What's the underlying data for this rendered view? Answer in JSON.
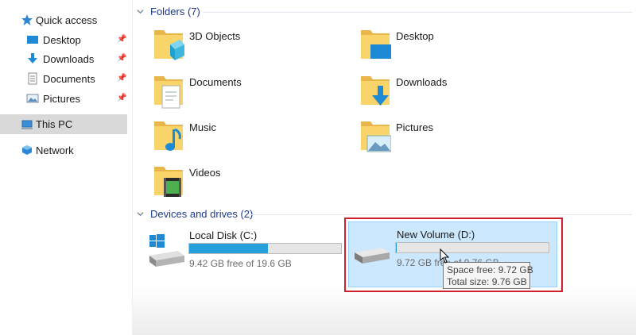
{
  "sidebar": {
    "quick_access": "Quick access",
    "items": [
      {
        "label": "Desktop",
        "icon": "desktop-icon",
        "pinned": true
      },
      {
        "label": "Downloads",
        "icon": "download-arrow-icon",
        "pinned": true
      },
      {
        "label": "Documents",
        "icon": "documents-icon",
        "pinned": true
      },
      {
        "label": "Pictures",
        "icon": "pictures-icon",
        "pinned": true
      }
    ],
    "this_pc": "This PC",
    "network": "Network"
  },
  "folders_group": {
    "header": "Folders (7)",
    "items": [
      {
        "label": "3D Objects",
        "icon": "3d-objects-folder-icon"
      },
      {
        "label": "Desktop",
        "icon": "desktop-folder-icon"
      },
      {
        "label": "Documents",
        "icon": "documents-folder-icon"
      },
      {
        "label": "Downloads",
        "icon": "downloads-folder-icon"
      },
      {
        "label": "Music",
        "icon": "music-folder-icon"
      },
      {
        "label": "Pictures",
        "icon": "pictures-folder-icon"
      },
      {
        "label": "Videos",
        "icon": "videos-folder-icon"
      }
    ]
  },
  "devices_group": {
    "header": "Devices and drives (2)",
    "drives": [
      {
        "name": "Local Disk (C:)",
        "free_text": "9.42 GB free of 19.6 GB",
        "used_fraction": 0.52,
        "icon": "windows-drive-icon"
      },
      {
        "name": "New Volume (D:)",
        "free_text": "9.72 GB free of 9.76 GB",
        "used_fraction": 0.004,
        "icon": "drive-icon",
        "selected": true
      }
    ]
  },
  "tooltip": {
    "space_free": "Space free: 9.72 GB",
    "total_size": "Total size: 9.76 GB"
  },
  "colors": {
    "selection": "#cce8ff",
    "highlight_frame": "#d0202b",
    "bar_fill": "#26a0da",
    "group_header": "#1e3a8a"
  }
}
